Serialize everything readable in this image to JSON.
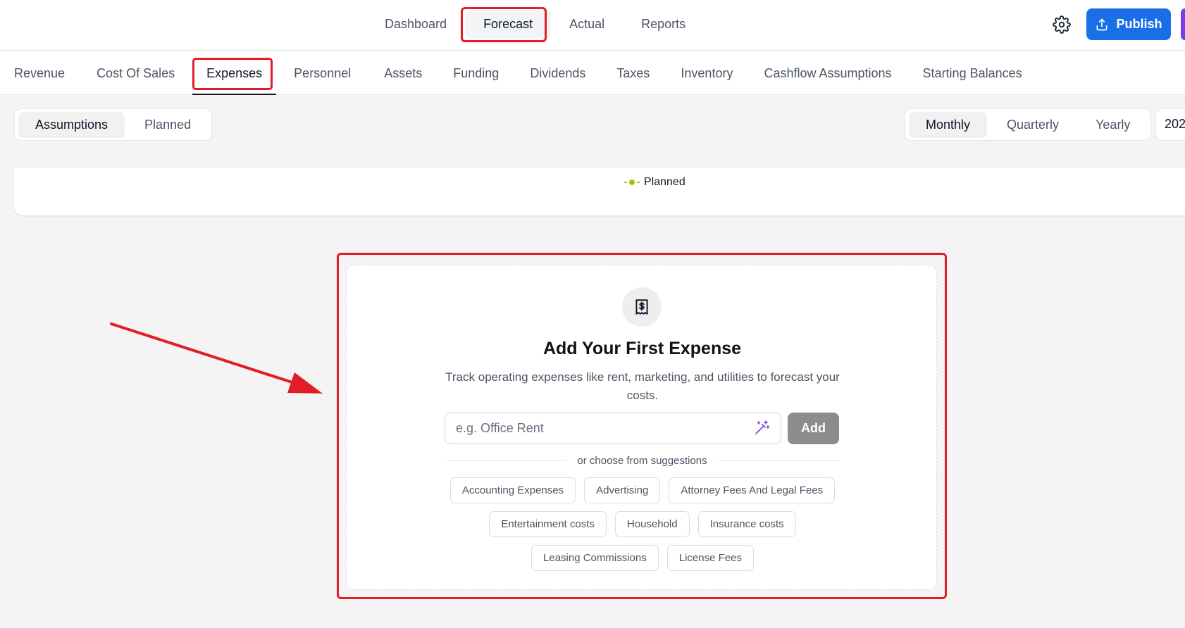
{
  "top_nav": {
    "items": [
      {
        "label": "Dashboard"
      },
      {
        "label": "Forecast"
      },
      {
        "label": "Actual"
      },
      {
        "label": "Reports"
      }
    ],
    "active": "Forecast",
    "publish_label": "Publish",
    "settings_icon": "gear-icon"
  },
  "sub_nav": {
    "items": [
      {
        "label": "Revenue"
      },
      {
        "label": "Cost Of Sales"
      },
      {
        "label": "Expenses"
      },
      {
        "label": "Personnel"
      },
      {
        "label": "Assets"
      },
      {
        "label": "Funding"
      },
      {
        "label": "Dividends"
      },
      {
        "label": "Taxes"
      },
      {
        "label": "Inventory"
      },
      {
        "label": "Cashflow Assumptions"
      },
      {
        "label": "Starting Balances"
      }
    ],
    "active": "Expenses"
  },
  "view_toggle": {
    "options": [
      {
        "label": "Assumptions"
      },
      {
        "label": "Planned"
      }
    ],
    "active": "Assumptions"
  },
  "period_toggle": {
    "options": [
      {
        "label": "Monthly"
      },
      {
        "label": "Quarterly"
      },
      {
        "label": "Yearly"
      }
    ],
    "active": "Monthly",
    "year_partial": "202"
  },
  "chart_legend": {
    "label": "Planned",
    "color": "#a3c019"
  },
  "empty_state": {
    "icon": "receipt-dollar-icon",
    "title": "Add Your First Expense",
    "description": "Track operating expenses like rent, marketing, and utilities to forecast your costs.",
    "input_placeholder": "e.g. Office Rent",
    "input_value": "",
    "add_label": "Add",
    "divider_text": "or choose from suggestions",
    "suggestions": [
      {
        "label": "Accounting Expenses"
      },
      {
        "label": "Advertising"
      },
      {
        "label": "Attorney Fees And Legal Fees"
      },
      {
        "label": "Entertainment costs"
      },
      {
        "label": "Household"
      },
      {
        "label": "Insurance costs"
      },
      {
        "label": "Leasing Commissions"
      },
      {
        "label": "License Fees"
      }
    ]
  },
  "colors": {
    "accent": "#1a6ee8",
    "annotation": "#e11d2a",
    "add_button": "#8c8c8c"
  }
}
